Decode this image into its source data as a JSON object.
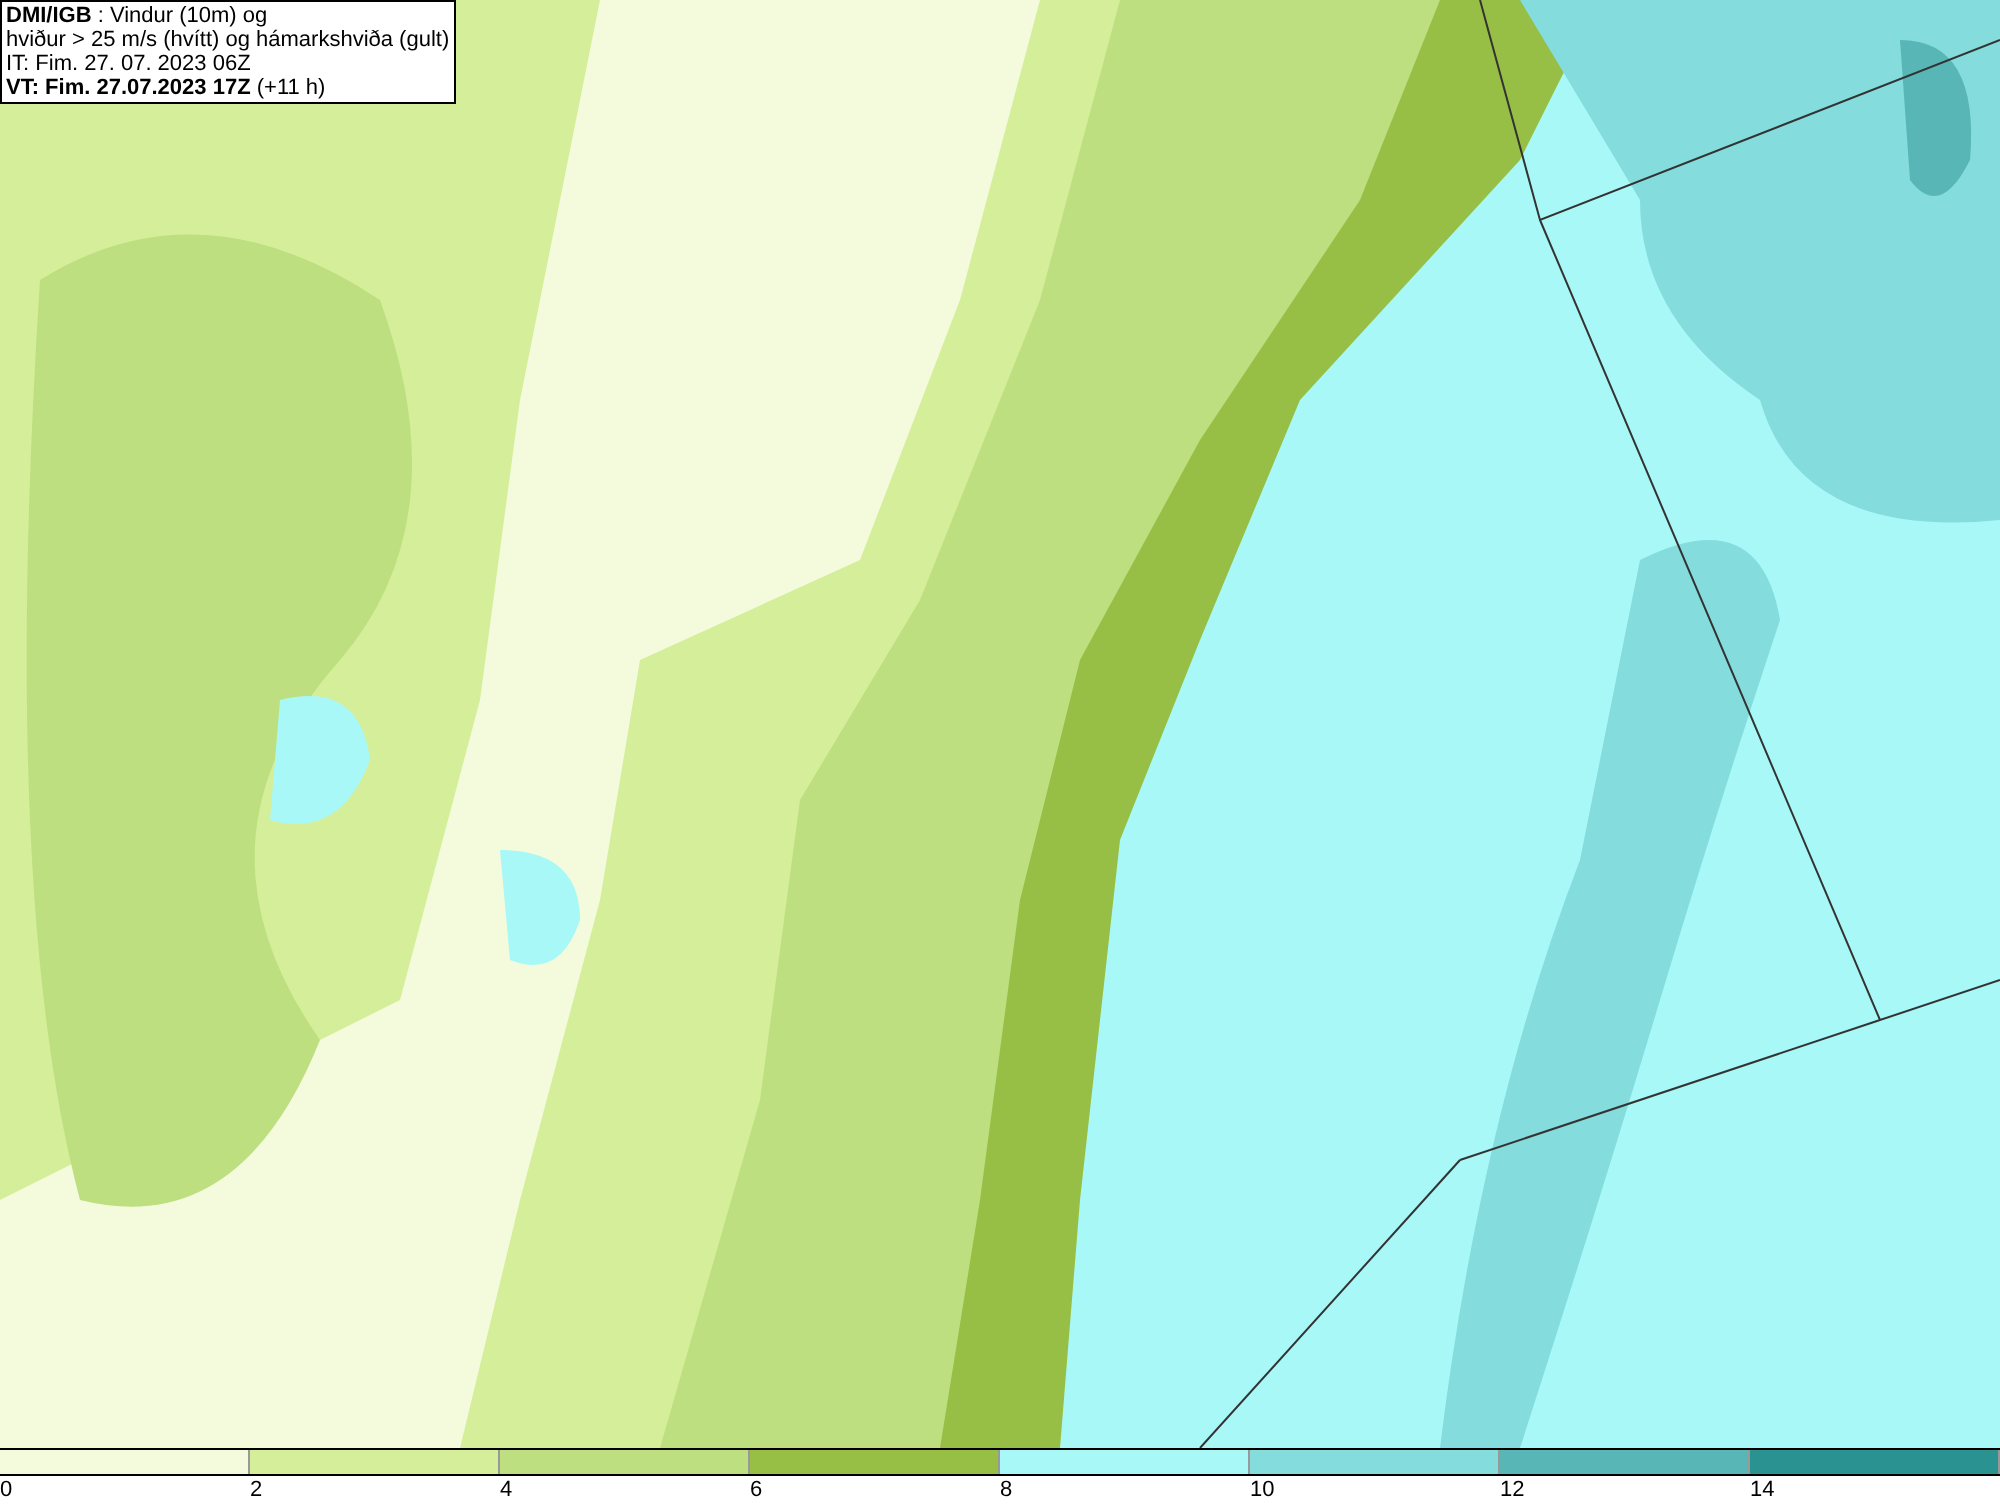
{
  "info_box": {
    "lines": [
      "**DMI/IGB** : Vindur (10m) og",
      "hviður > 25 m/s (hvítt) og hámarkshviða (gult)",
      "IT: Fim. 27. 07. 2023 06Z",
      "**VT: Fim. 27.07.2023 17Z** (+11 h)"
    ]
  },
  "color_bar": [
    {
      "label": "0",
      "color": "#f4fbdc"
    },
    {
      "label": "2",
      "color": "#d5ee9a"
    },
    {
      "label": "4",
      "color": "#bedf80"
    },
    {
      "label": "6",
      "color": "#97bf45"
    },
    {
      "label": "8",
      "color": "#a8f8f8"
    },
    {
      "label": "10",
      "color": "#84dcdc"
    },
    {
      "label": "12",
      "color": "#58b6b6"
    },
    {
      "label": "14",
      "color": "#2a9290"
    }
  ]
}
